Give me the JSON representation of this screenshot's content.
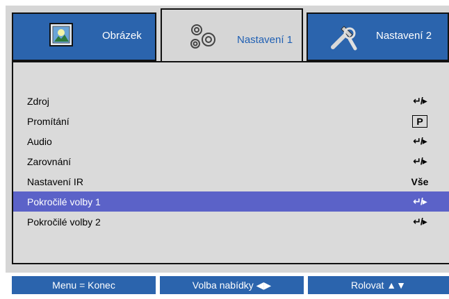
{
  "tabs": [
    {
      "label": "Obrázek",
      "icon": "picture-icon",
      "active": false
    },
    {
      "label": "Nastavení 1",
      "icon": "gears-icon",
      "active": true
    },
    {
      "label": "Nastavení 2",
      "icon": "tools-icon",
      "active": false
    }
  ],
  "menu": {
    "items": [
      {
        "label": "Zdroj",
        "value": "↵/▸"
      },
      {
        "label": "Promítání",
        "value": "P"
      },
      {
        "label": "Audio",
        "value": "↵/▸"
      },
      {
        "label": "Zarovnání",
        "value": "↵/▸"
      },
      {
        "label": "Nastavení IR",
        "value": "Vše"
      },
      {
        "label": "Pokročilé volby 1",
        "value": "↵/▸",
        "selected": true
      },
      {
        "label": "Pokročilé volby 2",
        "value": "↵/▸"
      }
    ]
  },
  "footer": {
    "menu_label": "Menu = Konec",
    "select_label": "Volba nabídky ◀▶",
    "scroll_label": "Rolovat ▲▼"
  },
  "colors": {
    "tab_blue": "#2b64ad",
    "selection": "#5b62c8",
    "panel": "#d6d6d6"
  }
}
